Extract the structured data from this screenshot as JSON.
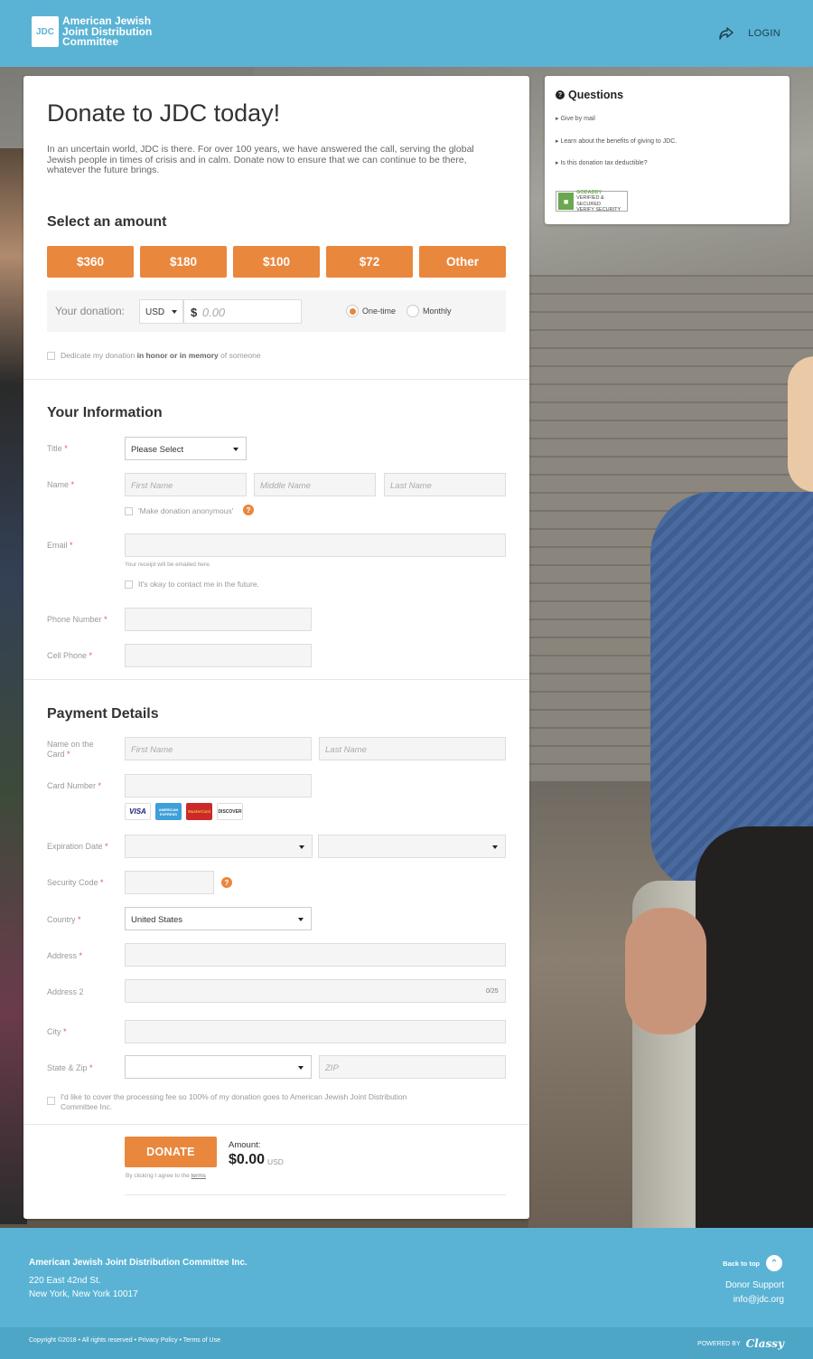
{
  "header": {
    "logo_mark": "JDC",
    "org_name": "American Jewish Joint Distribution Committee",
    "login_label": "LOGIN"
  },
  "form": {
    "title": "Donate to JDC today!",
    "intro": "In an uncertain world, JDC is there. For over 100 years, we have answered the call, serving the global Jewish people in times of crisis and in calm. Donate now to ensure that we can continue to be there, whatever the future brings.",
    "amount_section": {
      "title": "Select an amount",
      "options": [
        "$360",
        "$180",
        "$100",
        "$72",
        "Other"
      ],
      "donation_label": "Your donation:",
      "currency": "USD",
      "currency_symbol": "$",
      "amount_placeholder": "0.00",
      "frequency": [
        {
          "label": "One-time",
          "selected": true
        },
        {
          "label": "Monthly",
          "selected": false
        }
      ],
      "dedicate_pre": "Dedicate my donation ",
      "dedicate_bold": "in honor or in memory",
      "dedicate_post": " of someone"
    },
    "info_section": {
      "title": "Your Information",
      "title_label": "Title",
      "title_select": "Please Select",
      "name_label": "Name",
      "first_name_ph": "First Name",
      "middle_name_ph": "Middle Name",
      "last_name_ph": "Last Name",
      "anonymous_label": "'Make donation anonymous'",
      "email_label": "Email",
      "email_hint": "Your receipt will be emailed here.",
      "contact_label": "It's okay to contact me in the future.",
      "phone_label": "Phone Number",
      "cell_label": "Cell Phone"
    },
    "payment_section": {
      "title": "Payment Details",
      "name_on_card_label": "Name on the Card",
      "first_name_ph": "First Name",
      "last_name_ph": "Last Name",
      "card_number_label": "Card Number",
      "card_brands": [
        "VISA",
        "AMERICAN EXPRESS",
        "MasterCard",
        "DISCOVER"
      ],
      "expiration_label": "Expiration Date",
      "security_label": "Security Code",
      "country_label": "Country",
      "country_value": "United States",
      "address_label": "Address",
      "address2_label": "Address 2",
      "address2_counter": "0/25",
      "city_label": "City",
      "state_zip_label": "State & Zip",
      "zip_ph": "ZIP",
      "fee_label": "I'd like to cover the processing fee so 100% of my donation goes to American Jewish Joint Distribution Committee Inc."
    },
    "submit": {
      "donate_label": "DONATE",
      "agree_text": "By clicking I agree to the ",
      "terms_link": "terms",
      "amount_label": "Amount:",
      "amount_value": "$0.00",
      "amount_currency": "USD"
    }
  },
  "sidebar": {
    "title": "Questions",
    "links": [
      "Give by mail",
      "Learn about the benefits of giving to JDC.",
      "Is this donation tax deductible?"
    ],
    "seal_brand": "GODADDY",
    "seal_line1": "VERIFIED & SECURED",
    "seal_line2": "VERIFY SECURITY"
  },
  "footer": {
    "org": "American Jewish Joint Distribution Committee Inc.",
    "address1": "220 East 42nd St.",
    "address2": "New York, New York 10017",
    "back_to_top": "Back to top",
    "donor_support": "Donor Support",
    "email": "info@jdc.org",
    "copyright": "Copyright ©2018 • All rights reserved • Privacy Policy • Terms of Use",
    "powered_by": "POWERED BY",
    "powered_brand": "Classy"
  },
  "colors": {
    "header_blue": "#5ab3d4",
    "accent_orange": "#e9873d",
    "required_red": "#e05b4d"
  }
}
